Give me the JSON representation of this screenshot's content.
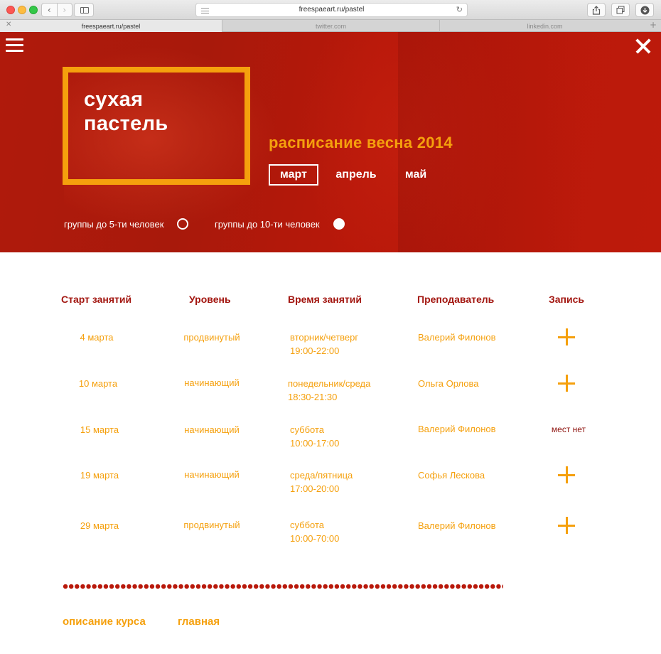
{
  "browser": {
    "url": "freespaeart.ru/pastel",
    "tabs": [
      {
        "label": "freespaeart.ru/pastel",
        "active": true
      },
      {
        "label": "twitter.com",
        "active": false
      },
      {
        "label": "linkedin.com",
        "active": false
      }
    ]
  },
  "hero": {
    "title_line1": "сухая",
    "title_line2": "пастель",
    "season": "расписание весна 2014",
    "months": [
      "март",
      "апрель",
      "май"
    ],
    "active_month": "март",
    "group_small": "группы до 5-ти человек",
    "group_large": "группы до 10-ти человек",
    "selected_group": "группы до 10-ти человек"
  },
  "table": {
    "headers": [
      "Старт занятий",
      "Уровень",
      "Время занятий",
      "Преподаватель",
      "Запись"
    ],
    "rows": [
      {
        "start": "4 марта",
        "level": "продвинутый",
        "days": "вторник/четверг",
        "time": "19:00-22:00",
        "teacher": "Валерий Филонов",
        "signup": "plus"
      },
      {
        "start": "10 марта",
        "level": "начинающий",
        "days": "понедельник/среда",
        "time": "18:30-21:30",
        "teacher": "Ольга Орлова",
        "signup": "plus"
      },
      {
        "start": "15 марта",
        "level": "начинающий",
        "days": "суббота",
        "time": "10:00-17:00",
        "teacher": "Валерий Филонов",
        "signup": "мест нет"
      },
      {
        "start": "19 марта",
        "level": "начинающий",
        "days": "среда/пятница",
        "time": "17:00-20:00",
        "teacher": "Софья Лескова",
        "signup": "plus"
      },
      {
        "start": "29 марта",
        "level": "продвинутый",
        "days": "суббота",
        "time": "10:00-70:00",
        "teacher": "Валерий Филонов",
        "signup": "plus"
      }
    ]
  },
  "footer": {
    "link_course": "описание курса",
    "link_home": "главная"
  },
  "colors": {
    "accent": "#f5a00d",
    "hero_red": "#b01a0c",
    "header_red": "#a31711"
  }
}
